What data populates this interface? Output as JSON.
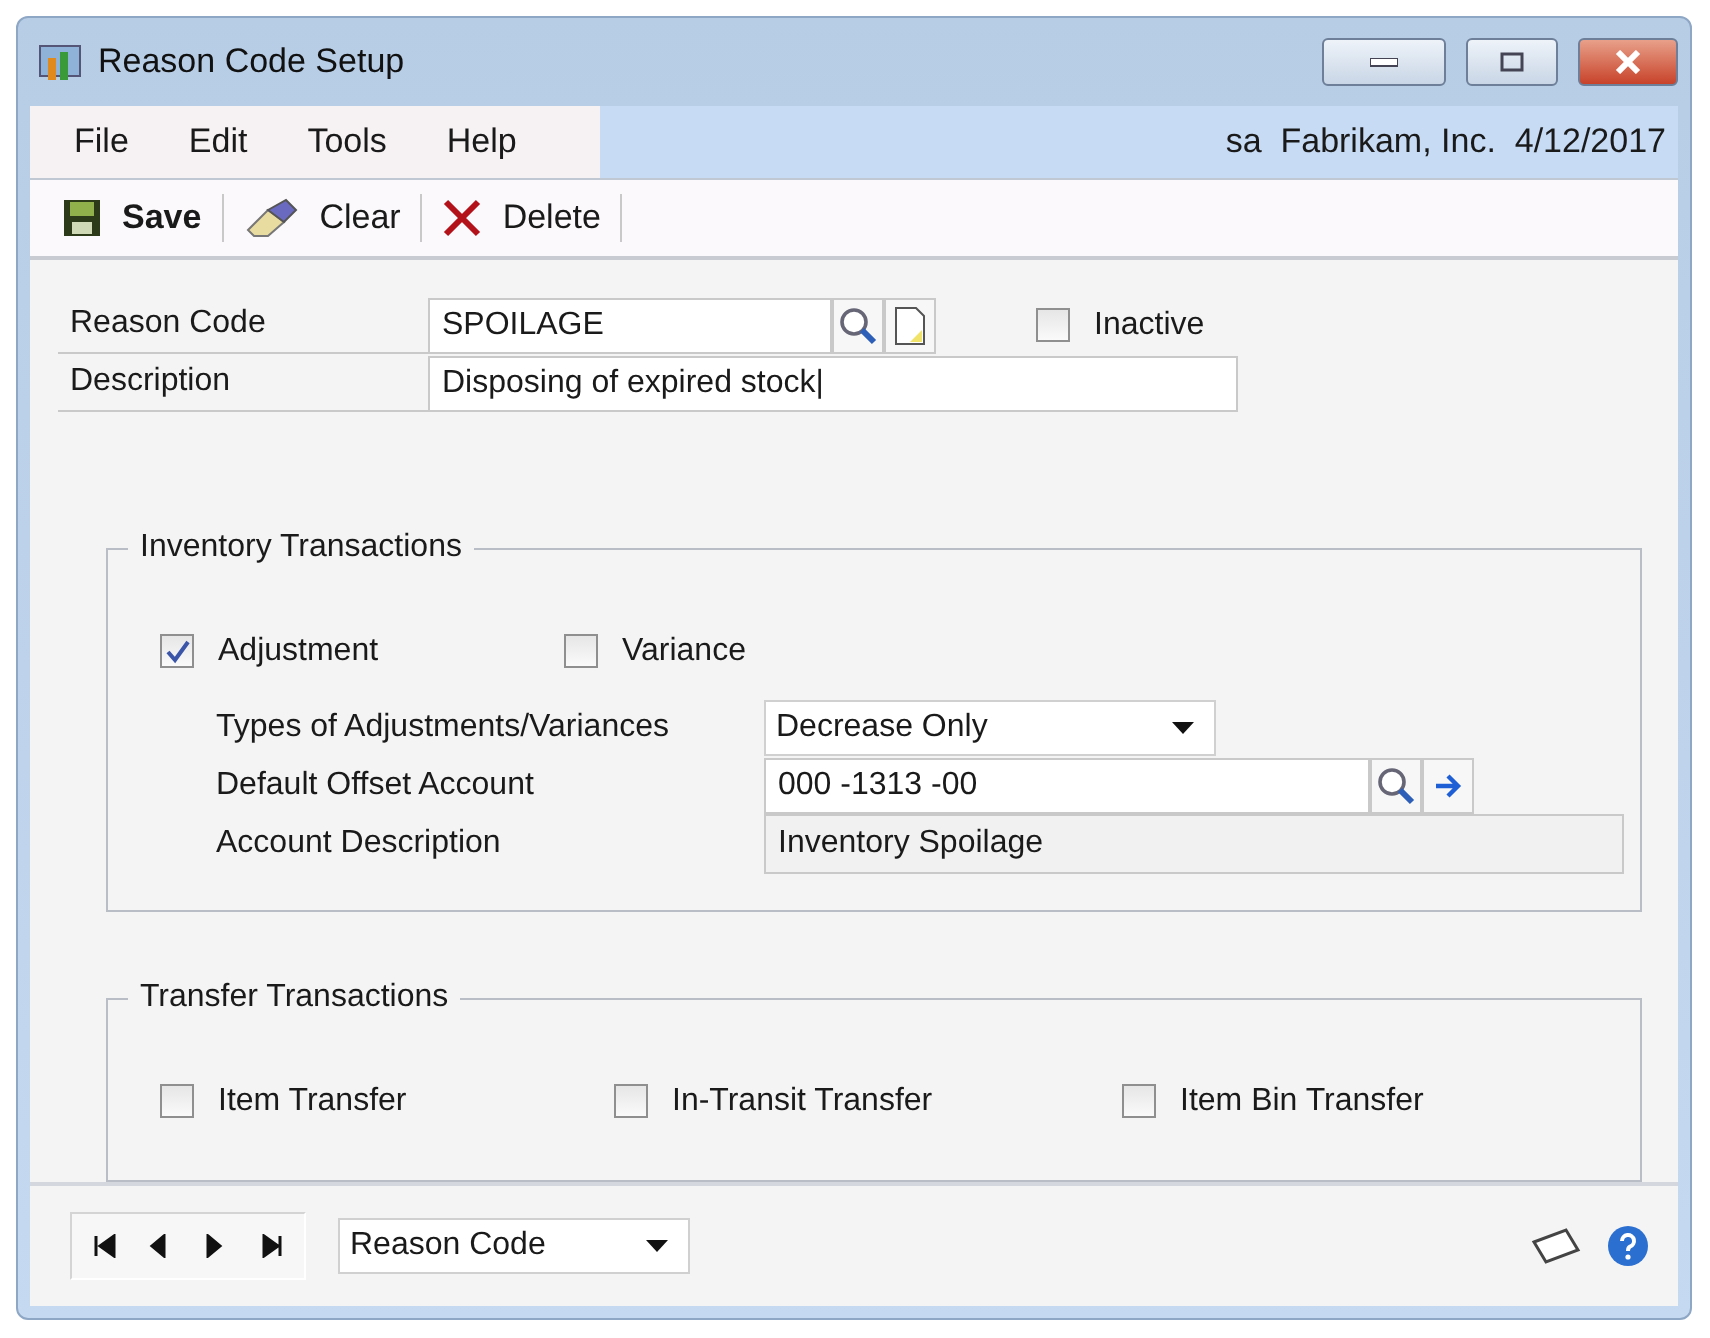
{
  "window": {
    "title": "Reason Code Setup"
  },
  "menu": [
    "File",
    "Edit",
    "Tools",
    "Help"
  ],
  "user_info": "sa  Fabrikam, Inc.  4/12/2017",
  "toolbar": [
    {
      "kind": "save",
      "label": "Save"
    },
    {
      "kind": "clear",
      "label": "Clear"
    },
    {
      "kind": "delete",
      "label": "Delete"
    }
  ],
  "reason_code": {
    "label": "Reason Code",
    "value": "SPOILAGE"
  },
  "inactive": {
    "label": "Inactive",
    "checked": false
  },
  "description": {
    "label": "Description",
    "value": "Disposing of expired stock|"
  },
  "inventory_transactions": {
    "title": "Inventory Transactions",
    "options": [
      {
        "label": "Adjustment",
        "checked": true
      },
      {
        "label": "Variance",
        "checked": false
      }
    ],
    "types": {
      "label": "Types of Adjustments/Variances",
      "value": "Decrease Only"
    },
    "offset_account": {
      "label": "Default Offset Account",
      "value": "000 -1313 -00"
    },
    "account_description": {
      "label": "Account Description",
      "value": "Inventory Spoilage"
    }
  },
  "transfer_transactions": {
    "title": "Transfer Transactions",
    "options": [
      {
        "label": "Item Transfer",
        "checked": false
      },
      {
        "label": "In-Transit Transfer",
        "checked": false
      },
      {
        "label": "Item Bin Transfer",
        "checked": false
      }
    ]
  },
  "browse_by": "Reason Code"
}
